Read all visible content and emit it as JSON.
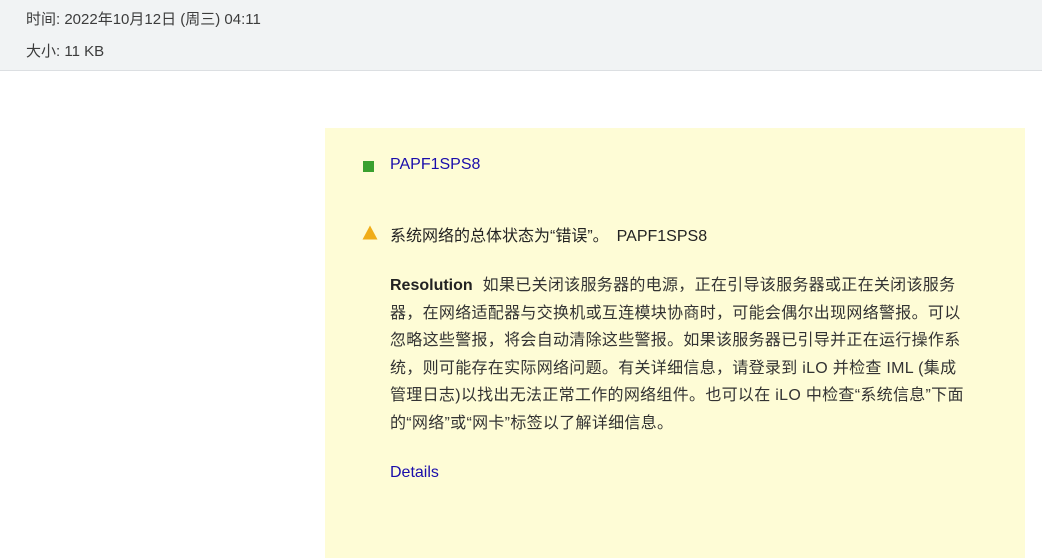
{
  "email_meta": {
    "time": "时间: 2022年10月12日 (周三) 04:11",
    "size": "大小: 11 KB"
  },
  "alert": {
    "server_name": "PAPF1SPS8",
    "status_color": "#3aa02f",
    "warning_color": "#f0ad18",
    "message": "系统网络的总体状态为“错误”。",
    "message_server": "PAPF1SPS8",
    "resolution_label": "Resolution",
    "resolution_text": "如果已关闭该服务器的电源，正在引导该服务器或正在关闭该服务器，在网络适配器与交换机或互连模块协商时，可能会偶尔出现网络警报。可以忽略这些警报，将会自动清除这些警报。如果该服务器已引导并正在运行操作系统，则可能存在实际网络问题。有关详细信息，请登录到 iLO 并检查 IML (集成管理日志)以找出无法正常工作的网络组件。也可以在 iLO 中检查“系统信息”下面的“网络”或“网卡”标签以了解详细信息。",
    "details_label": "Details"
  }
}
